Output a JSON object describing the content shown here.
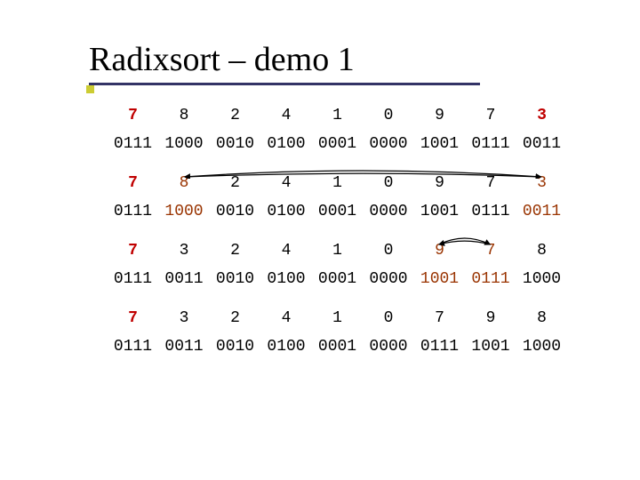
{
  "title": "Radixsort – demo 1",
  "colors": {
    "pivot": "#c00000",
    "moved": "#993300",
    "underline": "#333366",
    "dot": "#cccc33",
    "arrow": "#000000"
  },
  "steps": [
    {
      "decimal": [
        {
          "v": "7",
          "style": "pivot"
        },
        {
          "v": "8"
        },
        {
          "v": "2"
        },
        {
          "v": "4"
        },
        {
          "v": "1"
        },
        {
          "v": "0"
        },
        {
          "v": "9"
        },
        {
          "v": "7"
        },
        {
          "v": "3",
          "style": "pivot"
        }
      ],
      "binary": [
        {
          "v": "0111"
        },
        {
          "v": "1000"
        },
        {
          "v": "0010"
        },
        {
          "v": "0100"
        },
        {
          "v": "0001"
        },
        {
          "v": "0000"
        },
        {
          "v": "1001"
        },
        {
          "v": "0111"
        },
        {
          "v": "0011"
        }
      ]
    },
    {
      "swap": {
        "from": 1,
        "to": 8
      },
      "decimal": [
        {
          "v": "7",
          "style": "pivot"
        },
        {
          "v": "8",
          "style": "moved"
        },
        {
          "v": "2"
        },
        {
          "v": "4"
        },
        {
          "v": "1"
        },
        {
          "v": "0"
        },
        {
          "v": "9"
        },
        {
          "v": "7"
        },
        {
          "v": "3",
          "style": "moved"
        }
      ],
      "binary": [
        {
          "v": "0111"
        },
        {
          "v": "1000",
          "style": "moved"
        },
        {
          "v": "0010"
        },
        {
          "v": "0100"
        },
        {
          "v": "0001"
        },
        {
          "v": "0000"
        },
        {
          "v": "1001"
        },
        {
          "v": "0111"
        },
        {
          "v": "0011",
          "style": "moved"
        }
      ]
    },
    {
      "swap": {
        "from": 6,
        "to": 7
      },
      "decimal": [
        {
          "v": "7",
          "style": "pivot"
        },
        {
          "v": "3"
        },
        {
          "v": "2"
        },
        {
          "v": "4"
        },
        {
          "v": "1"
        },
        {
          "v": "0"
        },
        {
          "v": "9",
          "style": "moved"
        },
        {
          "v": "7",
          "style": "moved"
        },
        {
          "v": "8"
        }
      ],
      "binary": [
        {
          "v": "0111"
        },
        {
          "v": "0011"
        },
        {
          "v": "0010"
        },
        {
          "v": "0100"
        },
        {
          "v": "0001"
        },
        {
          "v": "0000"
        },
        {
          "v": "1001",
          "style": "moved"
        },
        {
          "v": "0111",
          "style": "moved"
        },
        {
          "v": "1000"
        }
      ]
    },
    {
      "decimal": [
        {
          "v": "7",
          "style": "pivot"
        },
        {
          "v": "3"
        },
        {
          "v": "2"
        },
        {
          "v": "4"
        },
        {
          "v": "1"
        },
        {
          "v": "0"
        },
        {
          "v": "7"
        },
        {
          "v": "9"
        },
        {
          "v": "8"
        }
      ],
      "binary": [
        {
          "v": "0111"
        },
        {
          "v": "0011"
        },
        {
          "v": "0010"
        },
        {
          "v": "0100"
        },
        {
          "v": "0001"
        },
        {
          "v": "0000"
        },
        {
          "v": "0111"
        },
        {
          "v": "1001"
        },
        {
          "v": "1000"
        }
      ]
    }
  ]
}
